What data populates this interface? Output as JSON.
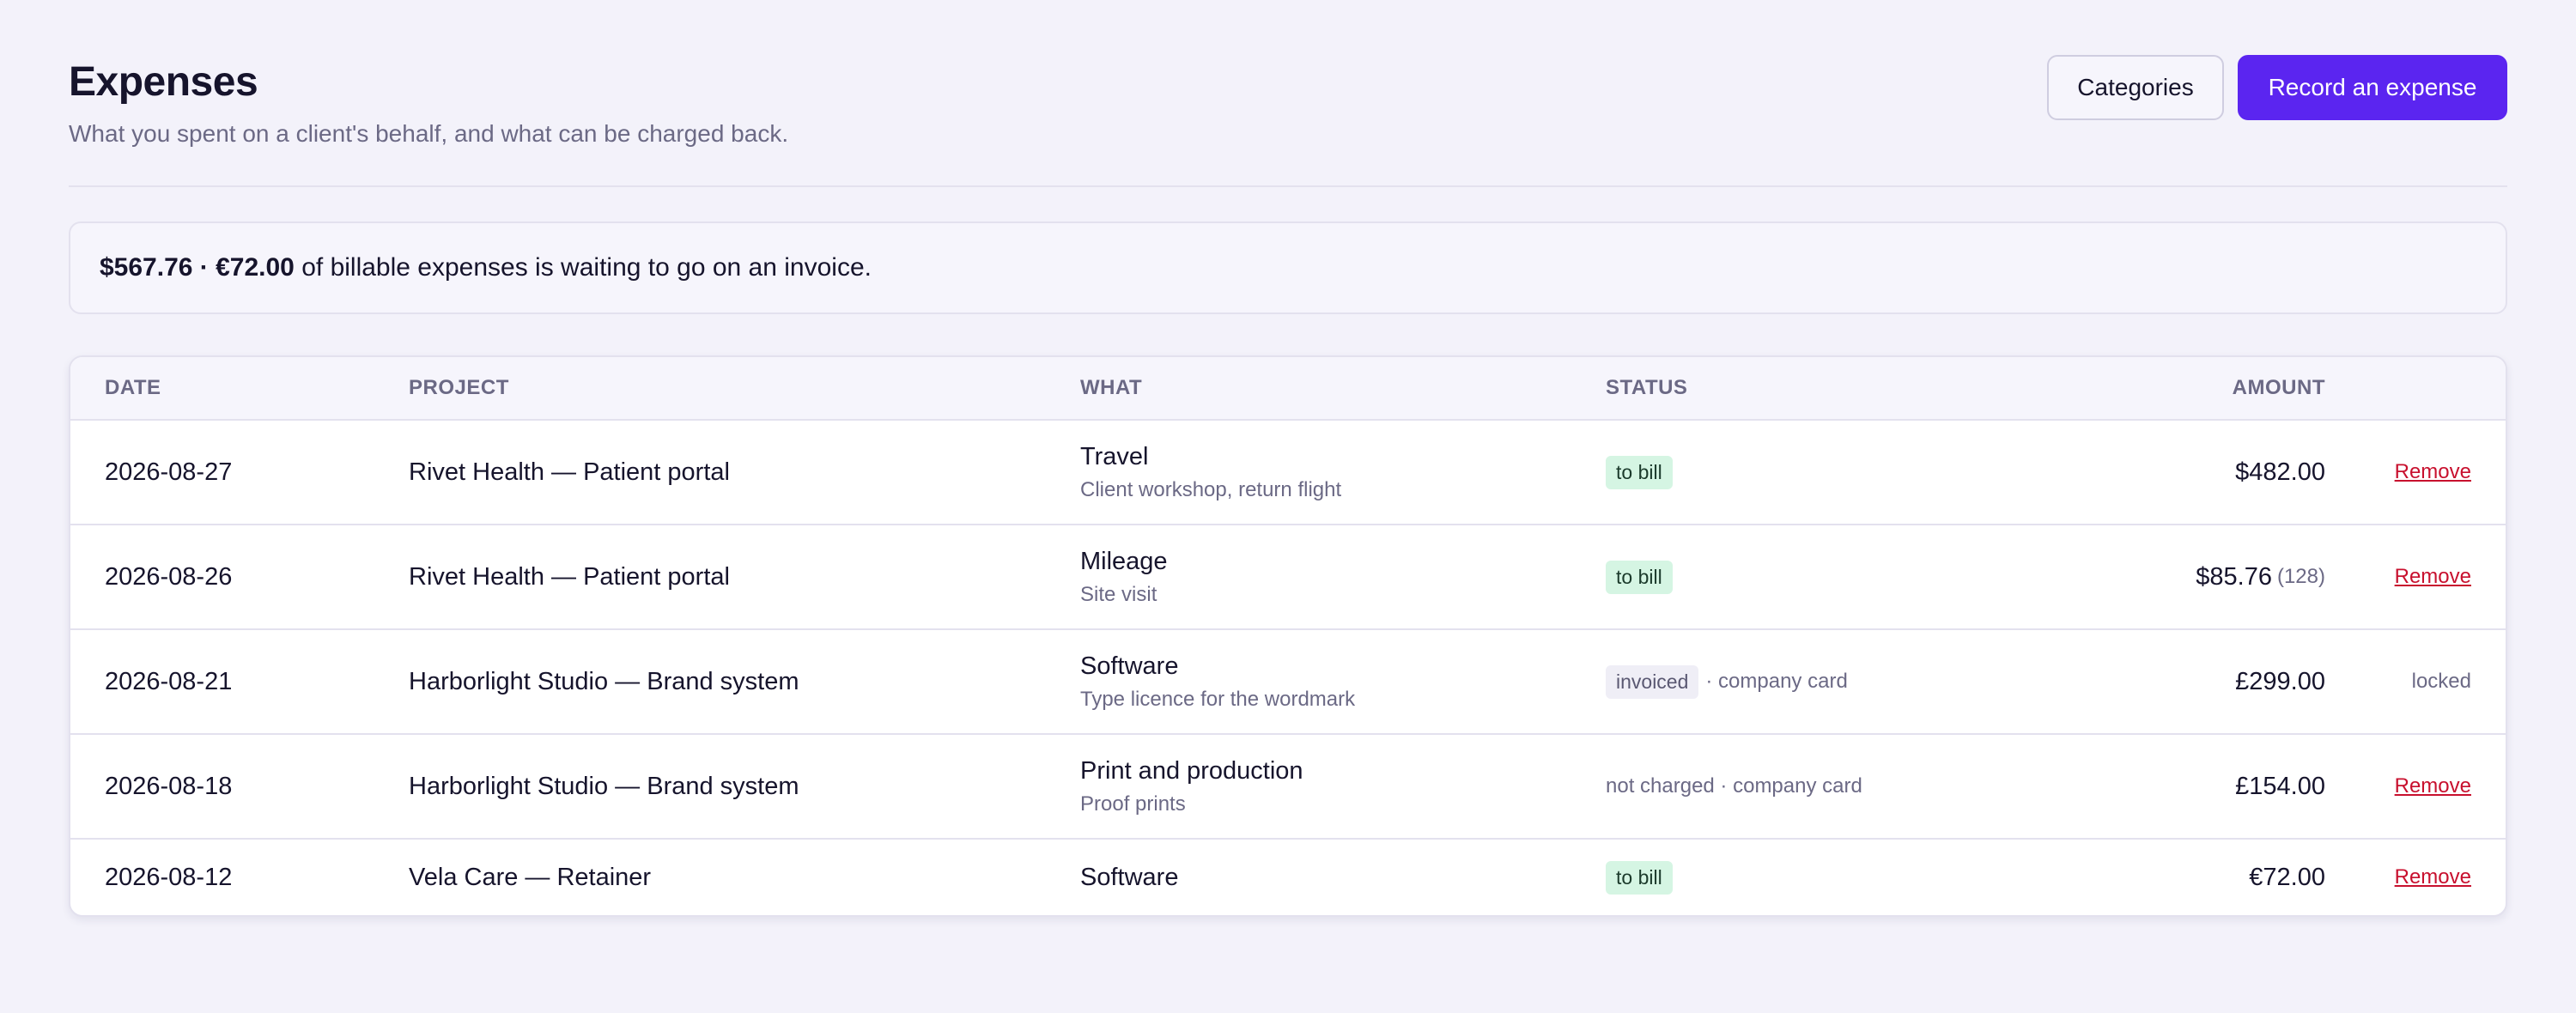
{
  "header": {
    "title": "Expenses",
    "subtitle": "What you spent on a client's behalf, and what can be charged back.",
    "categories_label": "Categories",
    "record_label": "Record an expense"
  },
  "summary": {
    "amounts": "$567.76 · €72.00",
    "text": " of billable expenses is waiting to go on an invoice."
  },
  "table": {
    "columns": {
      "date": "DATE",
      "project": "PROJECT",
      "what": "WHAT",
      "status": "STATUS",
      "amount": "AMOUNT"
    },
    "rows": [
      {
        "date": "2026-08-27",
        "project": "Rivet Health — Patient portal",
        "what": "Travel",
        "what_detail": "Client workshop, return flight",
        "status_badge": "to bill",
        "status_text": "",
        "amount": "$482.00",
        "amount_extra": "",
        "action": "Remove"
      },
      {
        "date": "2026-08-26",
        "project": "Rivet Health — Patient portal",
        "what": "Mileage",
        "what_detail": "Site visit",
        "status_badge": "to bill",
        "status_text": "",
        "amount": "$85.76",
        "amount_extra": "(128)",
        "action": "Remove"
      },
      {
        "date": "2026-08-21",
        "project": "Harborlight Studio — Brand system",
        "what": "Software",
        "what_detail": "Type licence for the wordmark",
        "status_badge": "invoiced",
        "status_text": "· company card",
        "amount": "£299.00",
        "amount_extra": "",
        "action": "locked"
      },
      {
        "date": "2026-08-18",
        "project": "Harborlight Studio — Brand system",
        "what": "Print and production",
        "what_detail": "Proof prints",
        "status_badge": "",
        "status_text": "not charged · company card",
        "amount": "£154.00",
        "amount_extra": "",
        "action": "Remove"
      },
      {
        "date": "2026-08-12",
        "project": "Vela Care — Retainer",
        "what": "Software",
        "what_detail": "",
        "status_badge": "to bill",
        "status_text": "",
        "amount": "€72.00",
        "amount_extra": "",
        "action": "Remove"
      }
    ]
  },
  "colors": {
    "accent": "#5b25f0",
    "to_bill_badge": "#d5f5e3",
    "remove_link": "#c8102e",
    "background": "#f3f2fa"
  }
}
